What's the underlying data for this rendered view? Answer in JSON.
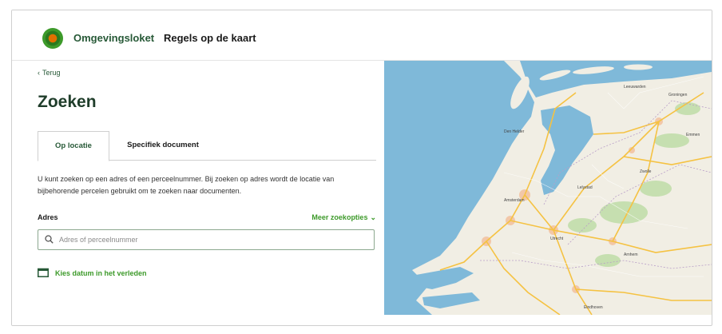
{
  "header": {
    "app_name": "Omgevingsloket",
    "nav_rules": "Regels op de kaart"
  },
  "panel": {
    "back_label": "Terug",
    "title": "Zoeken",
    "tabs": [
      {
        "label": "Op locatie",
        "active": true
      },
      {
        "label": "Specifiek document",
        "active": false
      }
    ],
    "description": "U kunt zoeken op een adres of een perceelnummer. Bij zoeken op adres wordt de locatie van bijbehorende percelen gebruikt om te zoeken naar documenten.",
    "address_label": "Adres",
    "more_options": "Meer zoekopties",
    "search_placeholder": "Adres of perceelnummer",
    "date_link": "Kies datum in het verleden"
  },
  "map": {
    "labels": [
      "Den Helder",
      "Amsterdam",
      "Utrecht",
      "Zwolle",
      "Groningen",
      "Arnhem",
      "Lelystad",
      "Leeuwarden",
      "Emmen",
      "Eindhoven"
    ]
  },
  "colors": {
    "brand_green": "#275937",
    "accent_green": "#3d9a2a",
    "logo_orange": "#e17000",
    "sea": "#7fb9d9",
    "land": "#f1eee4"
  },
  "icons": {
    "logo": "omgevingsloket-logo-icon",
    "back": "chevron-left-icon",
    "more": "chevron-down-icon",
    "search": "search-icon",
    "calendar": "calendar-icon"
  }
}
